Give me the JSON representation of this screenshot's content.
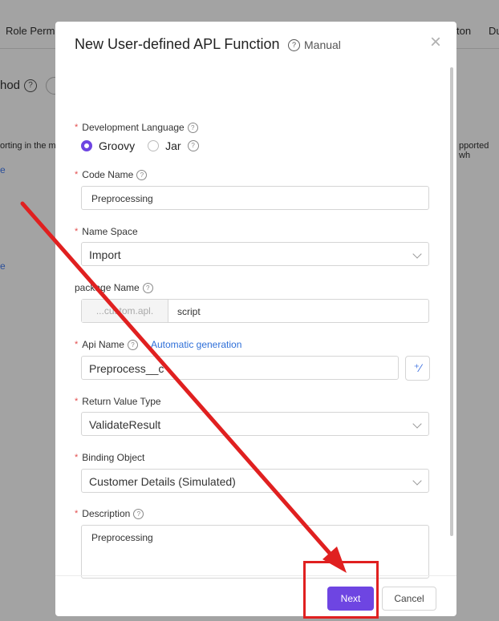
{
  "background": {
    "tab_left": "Role Perm",
    "tab_right_1": "ton",
    "tab_right_2": "Du",
    "method_label": "hod",
    "text_left": "orting in the m",
    "text_right": "pported wh",
    "link_1": "e",
    "link_2": "e"
  },
  "modal": {
    "title": "New User-defined APL Function",
    "manual_label": "Manual",
    "close_icon": "close-icon",
    "fields": {
      "dev_language": {
        "label": "Development Language",
        "options": [
          "Groovy",
          "Jar"
        ],
        "selected": "Groovy"
      },
      "code_name": {
        "label": "Code Name",
        "value": "Preprocessing"
      },
      "name_space": {
        "label": "Name Space",
        "value": "Import"
      },
      "package_name": {
        "label": "package Name",
        "prefix": "...custom.apl.",
        "value": "script"
      },
      "api_name": {
        "label": "Api Name",
        "link": "Automatic generation",
        "value": "Preprocess__c"
      },
      "return_type": {
        "label": "Return Value Type",
        "value": "ValidateResult"
      },
      "binding_object": {
        "label": "Binding Object",
        "value": "Customer Details (Simulated)"
      },
      "description": {
        "label": "Description",
        "value": "Preprocessing"
      }
    },
    "footer": {
      "next_label": "Next",
      "cancel_label": "Cancel"
    }
  },
  "colors": {
    "accent": "#6e45e2",
    "annotation": "#e02020",
    "link": "#2e6fd8",
    "required": "#e34d4d"
  }
}
